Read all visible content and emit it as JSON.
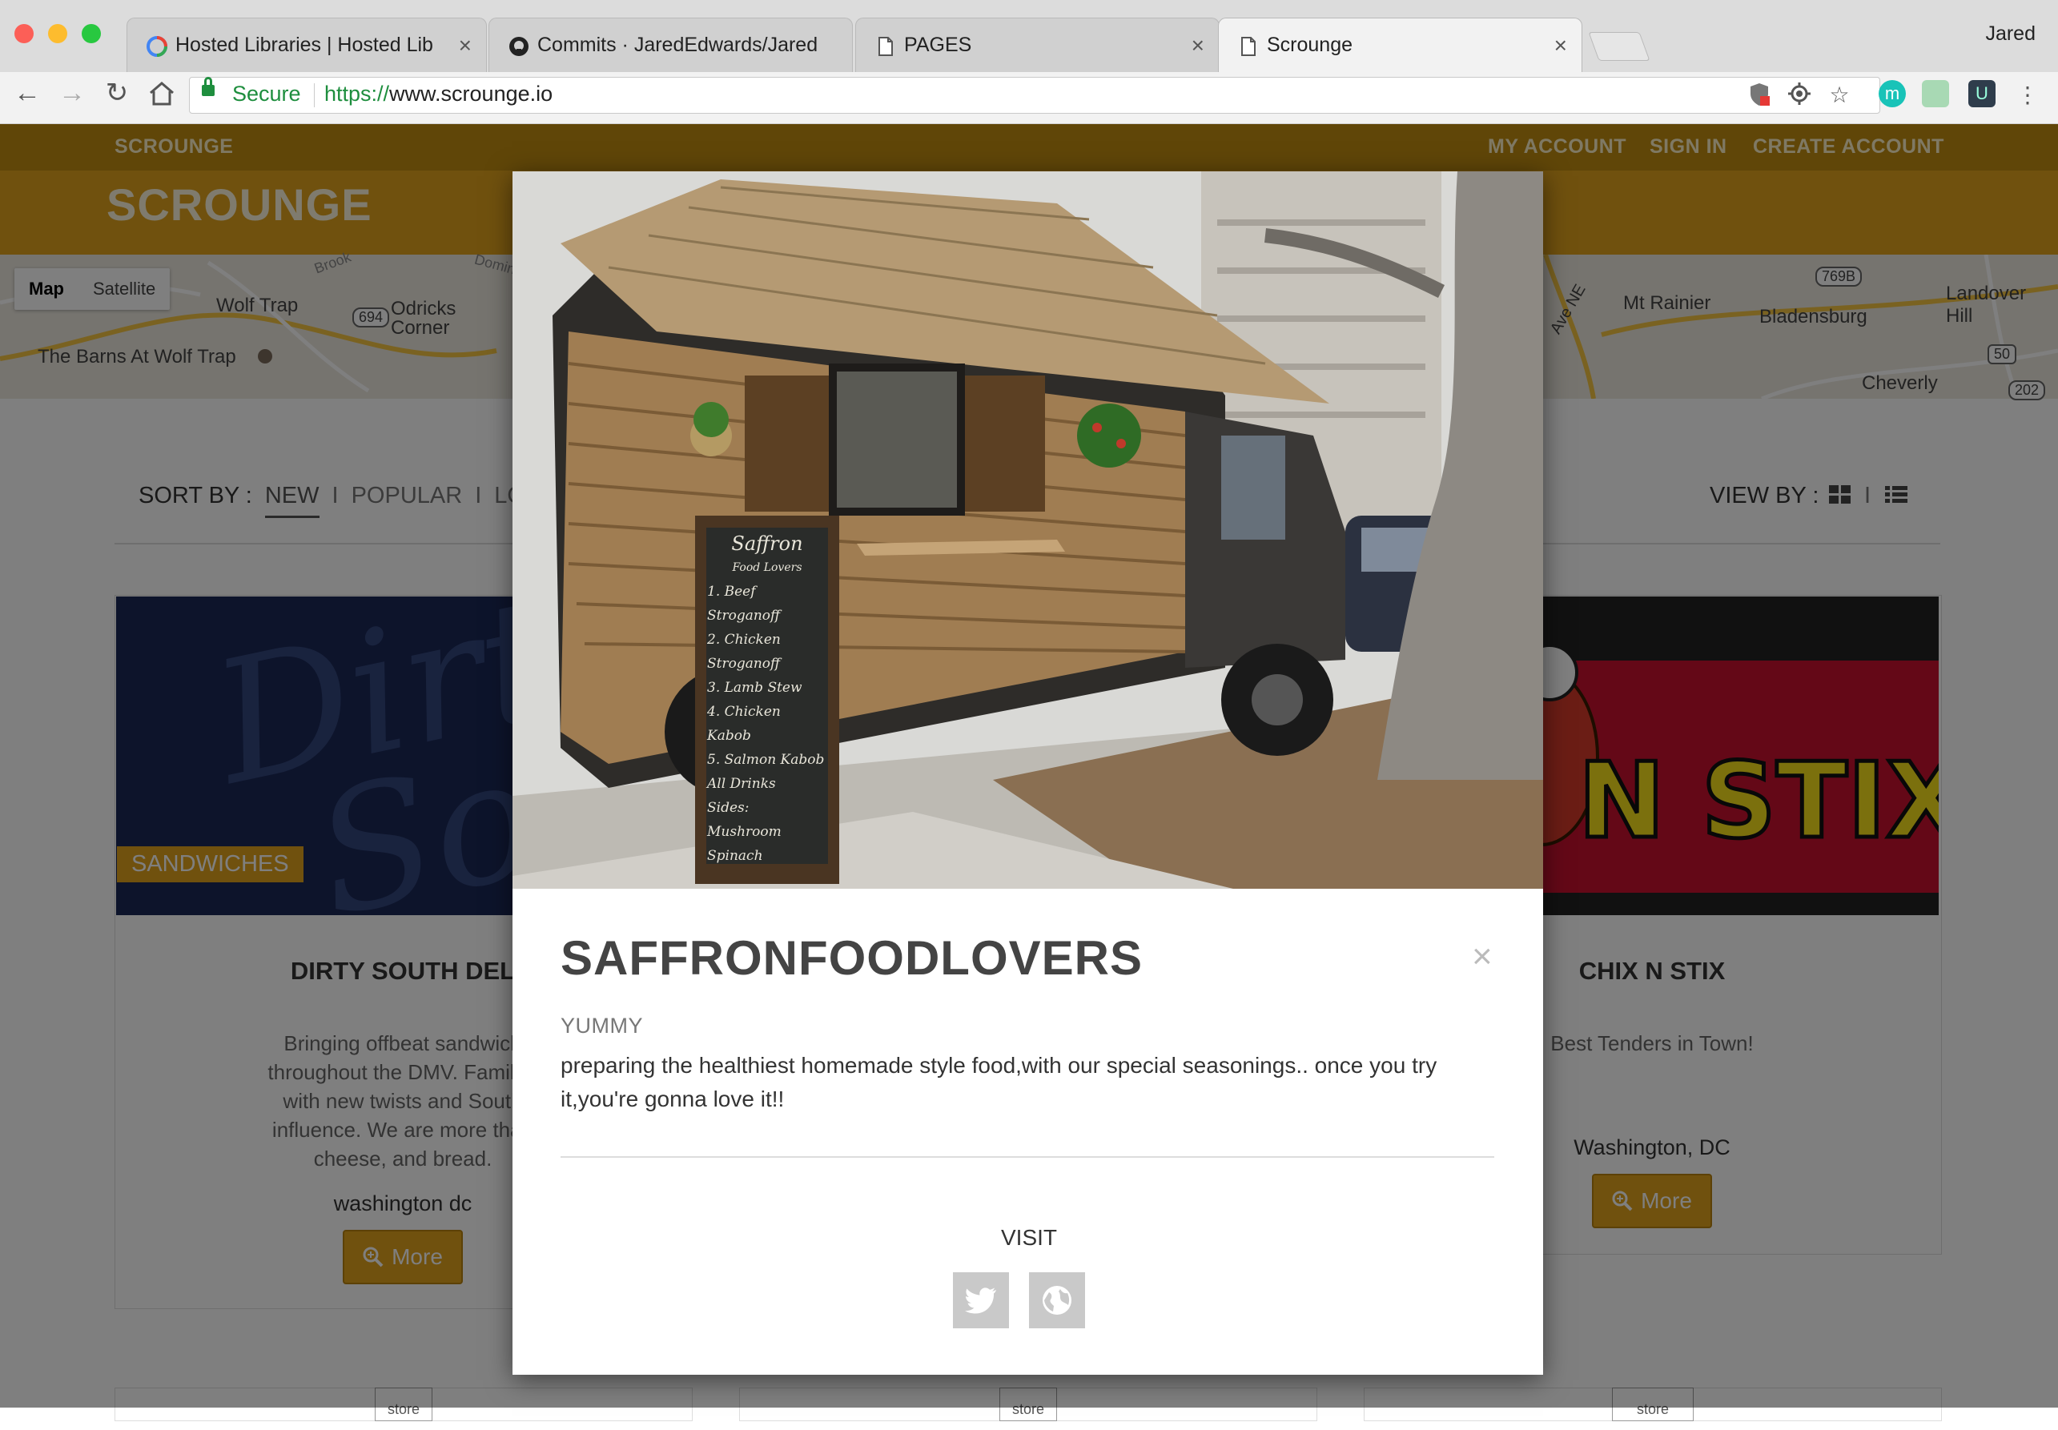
{
  "browser": {
    "tabs": [
      {
        "title": "Hosted Libraries  |  Hosted Lib",
        "icon": "google-developers-icon"
      },
      {
        "title": "Commits · JaredEdwards/Jared",
        "icon": "github-icon"
      },
      {
        "title": "PAGES",
        "icon": "page-icon"
      },
      {
        "title": "Scrounge",
        "icon": "page-icon"
      }
    ],
    "profile": "Jared",
    "secure_label": "Secure",
    "url_scheme": "https://",
    "url_rest": "www.scrounge.io"
  },
  "nav": {
    "brand": "SCROUNGE",
    "my_account": "MY ACCOUNT",
    "sign_in": "SIGN IN",
    "create_account": "CREATE ACCOUNT"
  },
  "hero": {
    "title": "SCROUNGE"
  },
  "map": {
    "map_label": "Map",
    "satellite_label": "Satellite",
    "places": [
      "Wolf Trap",
      "Odricks Corner",
      "The Barns At Wolf Trap",
      "Brook",
      "Domin",
      "Mt Rainier",
      "Bladensburg",
      "Landover Hill",
      "Cheverly",
      "Ave NE"
    ],
    "shields": [
      "694",
      "769B",
      "50",
      "202"
    ]
  },
  "sort": {
    "label": "SORT BY :",
    "options": [
      "NEW",
      "POPULAR",
      "LO"
    ],
    "separator": "I",
    "view_label": "VIEW BY :"
  },
  "cards": [
    {
      "title": "DIRTY SOUTH DEL",
      "badge": "SANDWICHES",
      "description": [
        "Bringing offbeat sandwich",
        "throughout the DMV. Familiar",
        "with new twists and South",
        "influence. We are more than",
        "cheese, and bread."
      ],
      "location": "washington dc",
      "more": "More"
    },
    {
      "title": "CHIX N STIX",
      "description": [
        "Best Tenders in Town!"
      ],
      "location": "Washington, DC",
      "more": "More",
      "image_text": "X N STIX"
    }
  ],
  "placeholder_label": "store",
  "modal": {
    "title": "SAFFRONFOODLOVERS",
    "close": "×",
    "tag": "YUMMY",
    "description": "preparing the healthiest homemade style food,with our special seasonings.. once you try it,you're gonna love it!!",
    "visit_label": "VISIT",
    "menu_board": {
      "name": "Saffron",
      "subtitle": "Food Lovers",
      "items": [
        "1. Beef Stroganoff",
        "2. Chicken Stroganoff",
        "3. Lamb Stew",
        "4. Chicken Kabob",
        "5. Salmon Kabob",
        "All Drinks",
        "Sides: Mushroom Spinach"
      ]
    }
  },
  "colors": {
    "nav_bg": "#c18d10",
    "hero_bg": "#e0a31c",
    "accent": "#e0a31c",
    "secure_green": "#1e8e3e"
  }
}
